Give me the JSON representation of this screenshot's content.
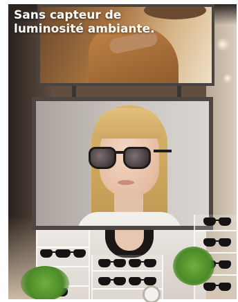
{
  "caption": {
    "line1": "Sans capteur de",
    "line2": "luminosité ambiante."
  }
}
